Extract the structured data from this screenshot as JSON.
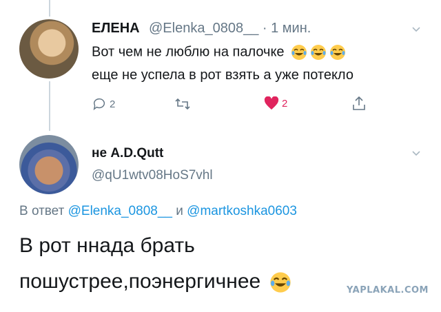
{
  "tweet1": {
    "name": "ЕЛЕНА",
    "handle": "@Elenka_0808__",
    "time": "· 1 мин.",
    "line1": "Вот чем не люблю на палочке",
    "line2": "еще не успела в рот взять а уже потекло",
    "reply_count": "2",
    "like_count": "2"
  },
  "tweet2": {
    "name": "не A.D.Qutt",
    "handle": "@qU1wtv08HoS7vhl",
    "reply_prefix": "В ответ",
    "reply_user1": "@Elenka_0808__",
    "reply_and": "и",
    "reply_user2": "@martkoshka0603",
    "line1": "В рот ннада брать",
    "line2": "пошустрее,поэнергичнее"
  },
  "watermark": "YAPLAKAL.COM",
  "colors": {
    "like": "#e0245e",
    "link": "#1b95e0",
    "muted": "#657786"
  }
}
